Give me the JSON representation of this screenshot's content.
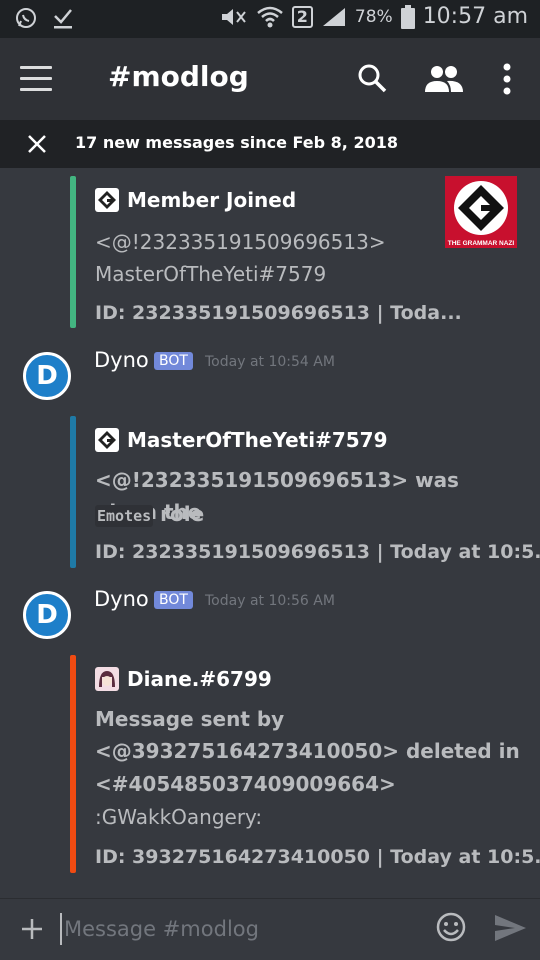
{
  "status_bar": {
    "battery": "78%",
    "time": "10:57 am",
    "sim": "2"
  },
  "toolbar": {
    "title": "#modlog"
  },
  "new_messages_bar": {
    "text": "17 new messages since Feb 8, 2018"
  },
  "embeds": [
    {
      "title": "Member Joined",
      "line1": "<@!232335191509696513>",
      "line2": "MasterOfTheYeti#7579",
      "footer": "ID: 232335191509696513 | Toda...",
      "thumbnail_caption": "THE GRAMMAR NAZI",
      "color": "#43b581"
    },
    {
      "title": "MasterOfTheYeti#7579",
      "line1": "<@!232335191509696513> was given the",
      "role": "Emotes",
      "role_suffix": "role",
      "footer": "ID: 232335191509696513 | Today at 10:5...",
      "color": "#1f7aa6"
    },
    {
      "title": "Diane.#6799",
      "line1": "Message sent by",
      "line2": "<@393275164273410050> deleted in",
      "line3": "<#405485037409009664>",
      "line4": ":GWakkOangery:",
      "footer": "ID: 393275164273410050 | Today at 10:5...",
      "color": "#f04b12"
    }
  ],
  "messages": [
    {
      "author": "Dyno",
      "badge": "BOT",
      "timestamp": "Today at 10:54 AM"
    },
    {
      "author": "Dyno",
      "badge": "BOT",
      "timestamp": "Today at 10:56 AM"
    }
  ],
  "composer": {
    "placeholder": "Message #modlog"
  }
}
